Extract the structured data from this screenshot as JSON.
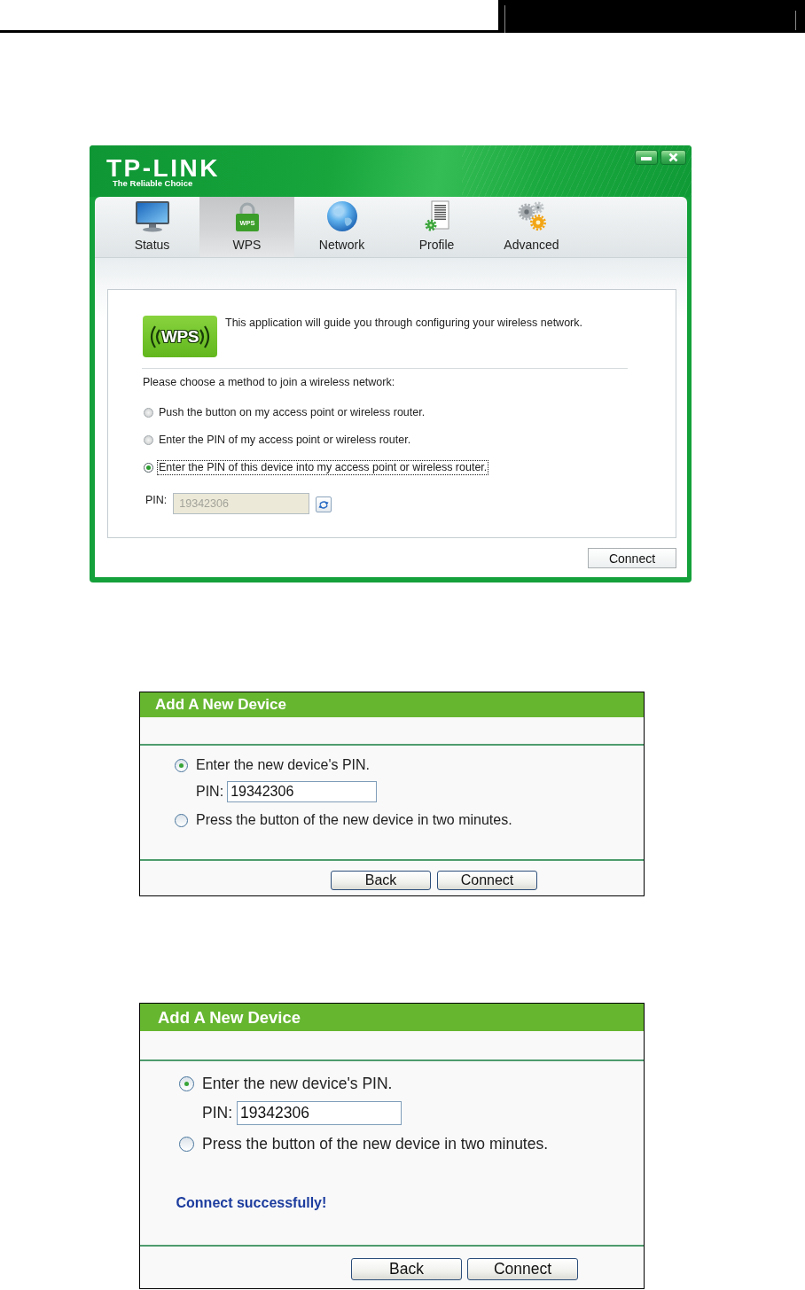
{
  "utility_window": {
    "logo": "TP-LINK",
    "tagline": "The Reliable Choice",
    "window_buttons": [
      {
        "kind": "minimize"
      },
      {
        "kind": "close"
      }
    ],
    "tabs": [
      {
        "label": "Status",
        "kind": "monitor",
        "selected": false
      },
      {
        "label": "WPS",
        "kind": "padlock",
        "icon_text": "WPS",
        "selected": true
      },
      {
        "label": "Network",
        "kind": "globe",
        "selected": false
      },
      {
        "label": "Profile",
        "kind": "document",
        "selected": false
      },
      {
        "label": "Advanced",
        "kind": "gears",
        "selected": false
      }
    ],
    "badge": "WPS",
    "intro": "This application will guide you through configuring your wireless network.",
    "prompt": "Please choose a method to join a wireless network:",
    "options": [
      {
        "label": "Push the button on my access point or wireless router.",
        "selected": false,
        "focused": false
      },
      {
        "label": "Enter the PIN of my access point or wireless router.",
        "selected": false,
        "focused": false
      },
      {
        "label": "Enter the PIN of this device into my access point or wireless router.",
        "selected": true,
        "focused": true
      }
    ],
    "pin": {
      "label": "PIN:",
      "value": "19342306",
      "disabled": true
    },
    "button": "Connect"
  },
  "router_pages": [
    {
      "title": "Add A New Device",
      "options": [
        {
          "label": "Enter the new device's PIN.",
          "selected": true,
          "pin": {
            "label": "PIN:",
            "value": "19342306"
          }
        },
        {
          "label": "Press the button of the new device in two minutes.",
          "selected": false
        }
      ],
      "buttons": [
        "Back",
        "Connect"
      ]
    },
    {
      "title": "Add A New Device",
      "options": [
        {
          "label": "Enter the new device's PIN.",
          "selected": true,
          "pin": {
            "label": "PIN:",
            "value": "19342306"
          }
        },
        {
          "label": "Press the button of the new device in two minutes.",
          "selected": false
        }
      ],
      "message": "Connect successfully!",
      "buttons": [
        "Back",
        "Connect"
      ]
    }
  ]
}
